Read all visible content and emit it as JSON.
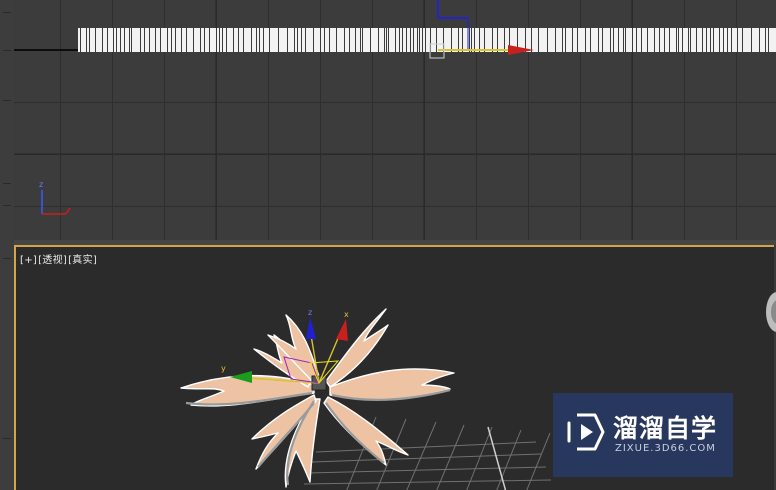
{
  "viewports": {
    "perspective": {
      "labels": [
        "[+]",
        "[透视]",
        "[真实]"
      ]
    }
  },
  "gizmo": {
    "top_axis_z": "z",
    "persp_axis_x": "x",
    "persp_axis_y": "y",
    "persp_axis_z": "z"
  },
  "watermark": {
    "title": "溜溜自学",
    "subtitle": "ZIXUE.3D66.COM"
  },
  "colors": {
    "active_viewport_border": "#d4a447",
    "petal_fill": "#edc3a4",
    "axis_x": "#c8201c",
    "axis_y": "#1c9c1c",
    "axis_z": "#2020d0",
    "watermark_bg": "#283a69"
  },
  "icons": {
    "watermark_logo": "play-hexagon-icon",
    "viewcube": "viewcube-icon"
  }
}
